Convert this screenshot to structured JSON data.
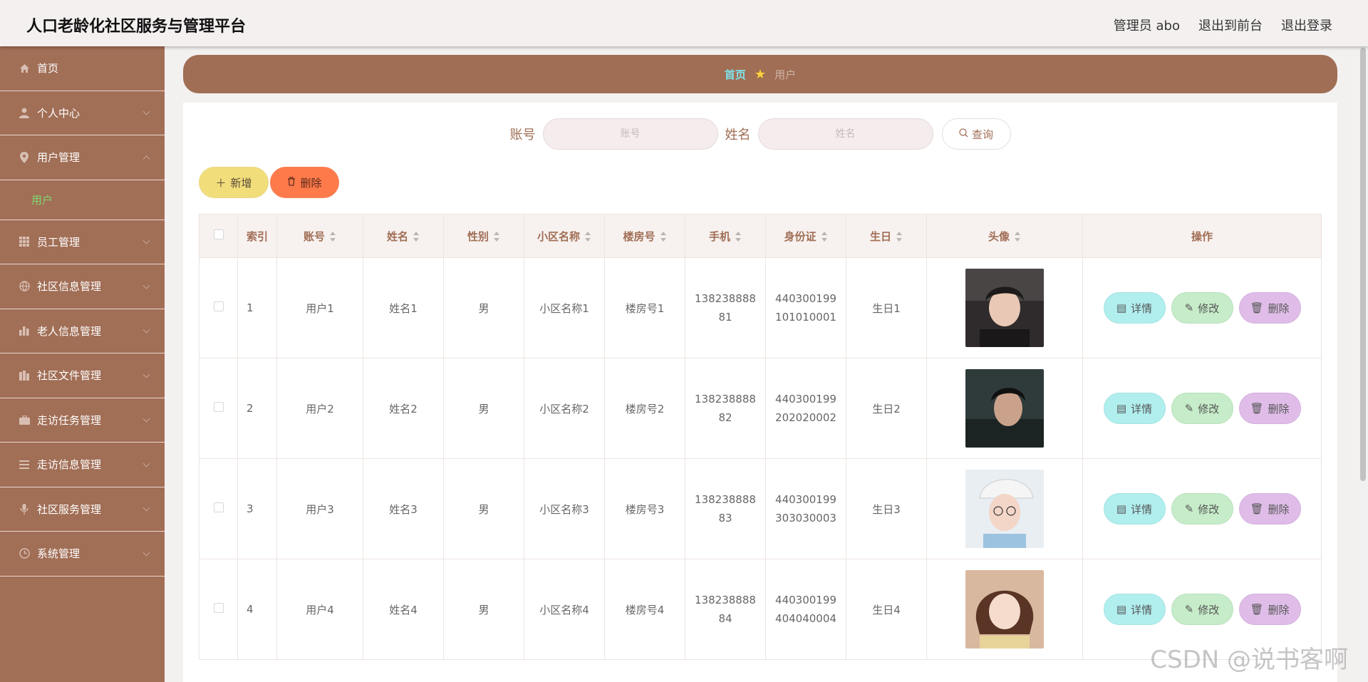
{
  "app": {
    "title": "人口老龄化社区服务与管理平台",
    "user": "管理员 abo",
    "front": "退出到前台",
    "logout": "退出登录"
  },
  "sidebar": {
    "items": [
      {
        "label": "首页",
        "icon": "home-icon",
        "chevron": false
      },
      {
        "label": "个人中心",
        "icon": "user-icon",
        "chevron": true
      },
      {
        "label": "用户管理",
        "icon": "location-pin-icon",
        "chevron": true,
        "expanded": true
      },
      {
        "label": "员工管理",
        "icon": "grid-icon",
        "chevron": true
      },
      {
        "label": "社区信息管理",
        "icon": "globe-icon",
        "chevron": true
      },
      {
        "label": "老人信息管理",
        "icon": "bar-chart-icon",
        "chevron": true
      },
      {
        "label": "社区文件管理",
        "icon": "building-icon",
        "chevron": true
      },
      {
        "label": "走访任务管理",
        "icon": "briefcase-icon",
        "chevron": true
      },
      {
        "label": "走访信息管理",
        "icon": "list-icon",
        "chevron": true
      },
      {
        "label": "社区服务管理",
        "icon": "microphone-icon",
        "chevron": true
      },
      {
        "label": "系统管理",
        "icon": "clock-icon",
        "chevron": true
      }
    ],
    "submenu": {
      "label": "用户"
    }
  },
  "breadcrumb": {
    "home": "首页",
    "current": "用户"
  },
  "search": {
    "account_label": "账号",
    "account_placeholder": "账号",
    "name_label": "姓名",
    "name_placeholder": "姓名",
    "query_label": "查询"
  },
  "toolbar": {
    "add_label": "新增",
    "delete_label": "删除"
  },
  "table": {
    "columns": [
      "索引",
      "账号",
      "姓名",
      "性别",
      "小区名称",
      "楼房号",
      "手机",
      "身份证",
      "生日",
      "头像",
      "操作"
    ],
    "rows": [
      {
        "index": "1",
        "account": "用户1",
        "name": "姓名1",
        "gender": "男",
        "community": "小区名称1",
        "building": "楼房号1",
        "phone": "13823888881",
        "id_card": "440300199101010001",
        "birthday": "生日1"
      },
      {
        "index": "2",
        "account": "用户2",
        "name": "姓名2",
        "gender": "男",
        "community": "小区名称2",
        "building": "楼房号2",
        "phone": "13823888882",
        "id_card": "440300199202020002",
        "birthday": "生日2"
      },
      {
        "index": "3",
        "account": "用户3",
        "name": "姓名3",
        "gender": "男",
        "community": "小区名称3",
        "building": "楼房号3",
        "phone": "13823888883",
        "id_card": "440300199303030003",
        "birthday": "生日3"
      },
      {
        "index": "4",
        "account": "用户4",
        "name": "姓名4",
        "gender": "男",
        "community": "小区名称4",
        "building": "楼房号4",
        "phone": "13823888884",
        "id_card": "440300199404040004",
        "birthday": "生日4"
      }
    ],
    "ops": {
      "detail": "详情",
      "edit": "修改",
      "delete": "删除"
    }
  },
  "watermark": "CSDN @说书客啊",
  "colors": {
    "sidebar": "#a16e56",
    "breadcrumb": "#a06e55",
    "accent_text": "#a06e55",
    "active_sub": "#7dd96f"
  }
}
